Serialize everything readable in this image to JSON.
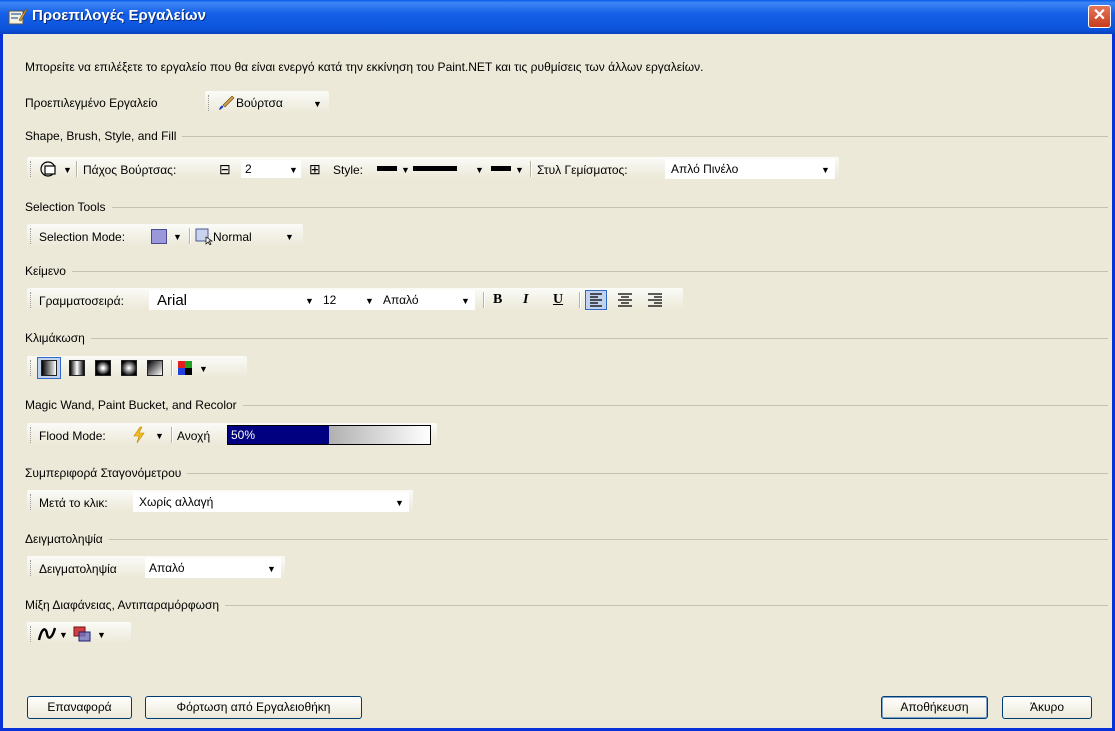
{
  "window": {
    "title": "Προεπιλογές Εργαλείων",
    "close": "✕"
  },
  "description": "Μπορείτε να επιλέξετε το εργαλείο που θα είναι ενεργό κατά την εκκίνηση του Paint.NET και τις ρυθμίσεις των άλλων εργαλείων.",
  "default_tool": {
    "label": "Προεπιλεγμένο Εργαλείο",
    "value": "Βούρτσα"
  },
  "sections": {
    "shape": "Shape, Brush, Style, and Fill",
    "selection": "Selection Tools",
    "text": "Κείμενο",
    "gradient": "Κλιμάκωση",
    "magic": "Magic Wand, Paint Bucket, and Recolor",
    "dropper": "Συμπεριφορά Σταγονόμετρου",
    "sampling": "Δειγματοληψία",
    "blend": "Μίξη Διαφάνειας, Αντιπαραμόρφωση"
  },
  "shape": {
    "brush_width_label": "Πάχος Βούρτσας:",
    "brush_width_value": "2",
    "minus": "⊟",
    "plus": "⊞",
    "style_label": "Style:",
    "fill_label": "Στυλ Γεμίσματος:",
    "fill_value": "Απλό Πινέλο"
  },
  "selection": {
    "mode_label": "Selection Mode:",
    "combine_value": "Normal"
  },
  "text": {
    "font_label": "Γραμματοσειρά:",
    "font_value": "Arial",
    "size_value": "12",
    "smoothing_value": "Απαλό",
    "bold": "B",
    "italic": "I",
    "underline": "U"
  },
  "magic": {
    "flood_label": "Flood Mode:",
    "tolerance_label": "Ανοχή",
    "tolerance_text": "50%",
    "tolerance_fraction": 0.5
  },
  "dropper": {
    "label": "Μετά το κλικ:",
    "value": "Χωρίς αλλαγή"
  },
  "sampling": {
    "label": "Δειγματοληψία",
    "value": "Απαλό"
  },
  "buttons": {
    "reset": "Επαναφορά",
    "load": "Φόρτωση από Εργαλειοθήκη",
    "save": "Αποθήκευση",
    "cancel": "Άκυρο"
  },
  "dropdown_arrow": "▼",
  "colors": {
    "title_bar": "#0b54db",
    "dialog_bg": "#ece9d8",
    "tolerance_fill": "#000080"
  }
}
